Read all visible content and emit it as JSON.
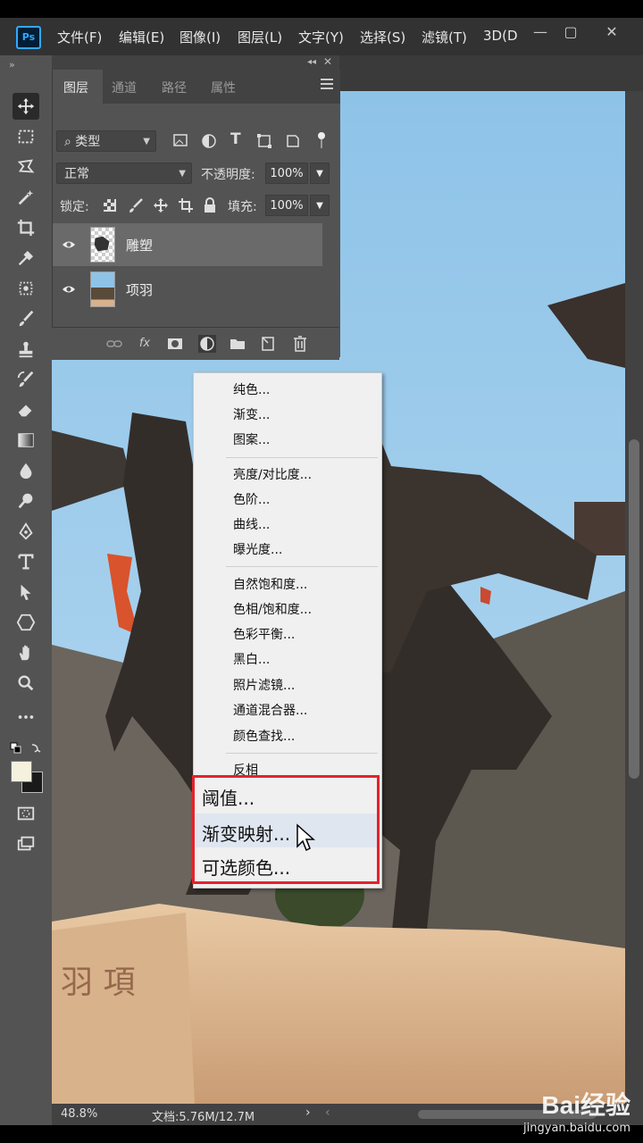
{
  "menubar": {
    "app_icon": "Ps",
    "items": [
      "文件(F)",
      "编辑(E)",
      "图像(I)",
      "图层(L)",
      "文字(Y)",
      "选择(S)",
      "滤镜(T)",
      "3D(D"
    ]
  },
  "toolbar": {
    "header": "»"
  },
  "layers_panel": {
    "tabs": [
      "图层",
      "通道",
      "路径",
      "属性"
    ],
    "filter_kind": "类型",
    "blend_mode": "正常",
    "opacity_label": "不透明度:",
    "opacity_value": "100%",
    "lock_label": "锁定:",
    "fill_label": "填充:",
    "fill_value": "100%",
    "layers": [
      {
        "name": "雕塑",
        "selected": true
      },
      {
        "name": "项羽",
        "selected": false
      }
    ],
    "footer_fx": "fx"
  },
  "adjustment_menu": {
    "group1": [
      "纯色...",
      "渐变...",
      "图案..."
    ],
    "group2": [
      "亮度/对比度...",
      "色阶...",
      "曲线...",
      "曝光度..."
    ],
    "group3": [
      "自然饱和度...",
      "色相/饱和度...",
      "色彩平衡...",
      "黑白...",
      "照片滤镜...",
      "通道混合器...",
      "颜色查找..."
    ],
    "invert": "反相",
    "highlighted": [
      "阈值...",
      "渐变映射...",
      "可选颜色..."
    ]
  },
  "status_bar": {
    "zoom": "48.8%",
    "doc_info": "文档:5.76M/12.7M"
  },
  "watermark": {
    "logo": "Bai经验",
    "url": "jingyan.baidu.com"
  },
  "colors": {
    "highlight_border": "#e3232c",
    "panel_bg": "#535353",
    "menu_bg": "#f0f0f0"
  }
}
